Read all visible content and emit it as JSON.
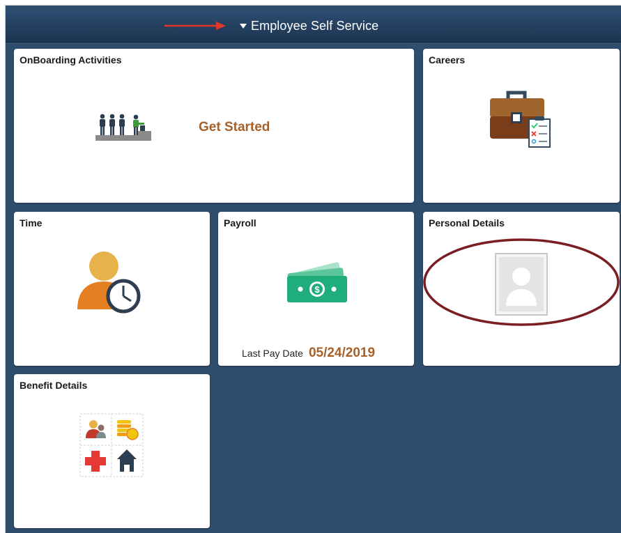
{
  "header": {
    "title": "Employee Self Service",
    "caret_icon": "caret-down-icon",
    "annotation_arrow_color": "#e2372a"
  },
  "tiles": {
    "onboarding": {
      "title": "OnBoarding Activities",
      "link_text": "Get Started",
      "icon": "people-on-steps-icon"
    },
    "careers": {
      "title": "Careers",
      "icon": "briefcase-checklist-icon"
    },
    "time": {
      "title": "Time",
      "icon": "person-clock-icon"
    },
    "payroll": {
      "title": "Payroll",
      "icon": "money-stack-icon",
      "last_pay_label": "Last Pay Date",
      "last_pay_date": "05/24/2019"
    },
    "personal_details": {
      "title": "Personal Details",
      "icon": "profile-photo-placeholder-icon",
      "annotation_circle_color": "#7a1e22"
    },
    "benefit_details": {
      "title": "Benefit Details",
      "icons": [
        "dependents-icon",
        "coins-icon",
        "medical-cross-icon",
        "home-icon"
      ]
    }
  },
  "colors": {
    "background": "#2f4d6c",
    "header": "#24405f",
    "accent_text": "#a6612a"
  }
}
